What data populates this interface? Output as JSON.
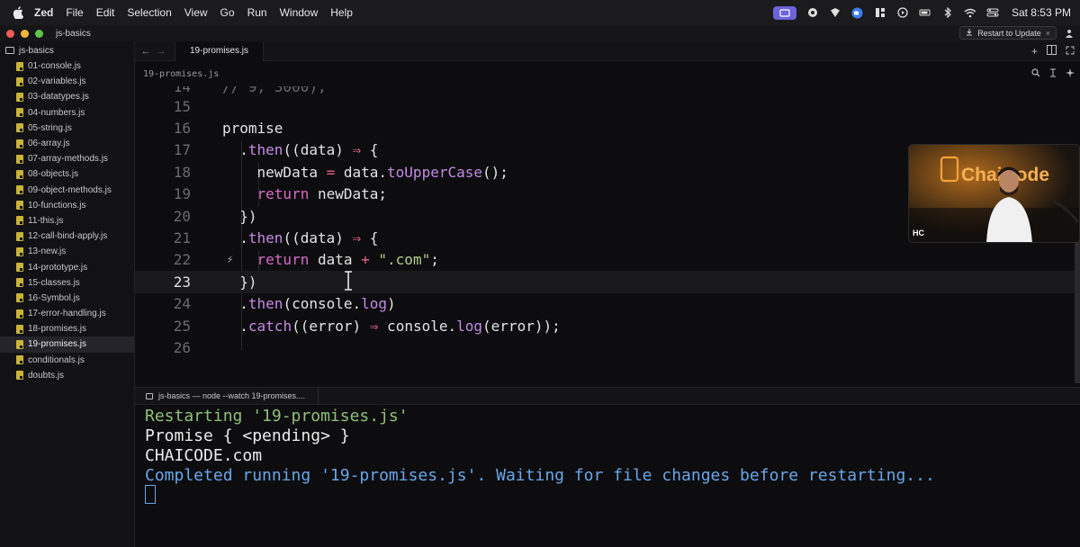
{
  "menubar": {
    "app": "Zed",
    "menus": [
      "File",
      "Edit",
      "Selection",
      "View",
      "Go",
      "Run",
      "Window",
      "Help"
    ],
    "clock": "Sat 8:53 PM"
  },
  "window": {
    "project": "js-basics",
    "restart_label": "Restart to Update",
    "restart_close": "×"
  },
  "sidebar": {
    "root": "js-basics",
    "files": [
      "01-console.js",
      "02-variables.js",
      "03-datatypes.js",
      "04-numbers.js",
      "05-string.js",
      "06-array.js",
      "07-array-methods.js",
      "08-objects.js",
      "09-object-methods.js",
      "10-functions.js",
      "11-this.js",
      "12-call-bind-apply.js",
      "13-new.js",
      "14-prototype.js",
      "15-classes.js",
      "16-Symbol.js",
      "17-error-handling.js",
      "18-promises.js",
      "19-promises.js",
      "conditionals.js",
      "doubts.js"
    ],
    "active_index": 18
  },
  "editor": {
    "tab": "19-promises.js",
    "breadcrumb": "19-promises.js",
    "current_line": "23",
    "line_numbers": [
      "15",
      "16",
      "17",
      "18",
      "19",
      "20",
      "21",
      "22",
      "23",
      "24",
      "25",
      "26"
    ],
    "partial_line_number": "14",
    "lines": [
      "",
      "promise",
      "  .then((data) ⇒ {",
      "    newData = data.toUpperCase();",
      "    return newData;",
      "  })",
      "  .then((data) ⇒ {",
      "    return data + \".com\";",
      "  })",
      "  .then(console.log)",
      "  .catch((error) ⇒ console.log(error));",
      ""
    ],
    "partial_top_line": "// 9, 3000);"
  },
  "terminal": {
    "tab": "js-basics — node --watch 19-promises....",
    "output": [
      "Restarting '19-promises.js'",
      "Promise { <pending> }",
      "CHAICODE.com",
      "Completed running '19-promises.js'. Waiting for file changes before restarting..."
    ]
  },
  "webcam": {
    "tag": "HC",
    "logo_text": "ChaiCode"
  },
  "colors": {
    "accent_purple": "#6b63d9",
    "js_yellow": "#c9b437",
    "terminal_green": "#8fc07a",
    "terminal_blue": "#6aa6e8"
  }
}
